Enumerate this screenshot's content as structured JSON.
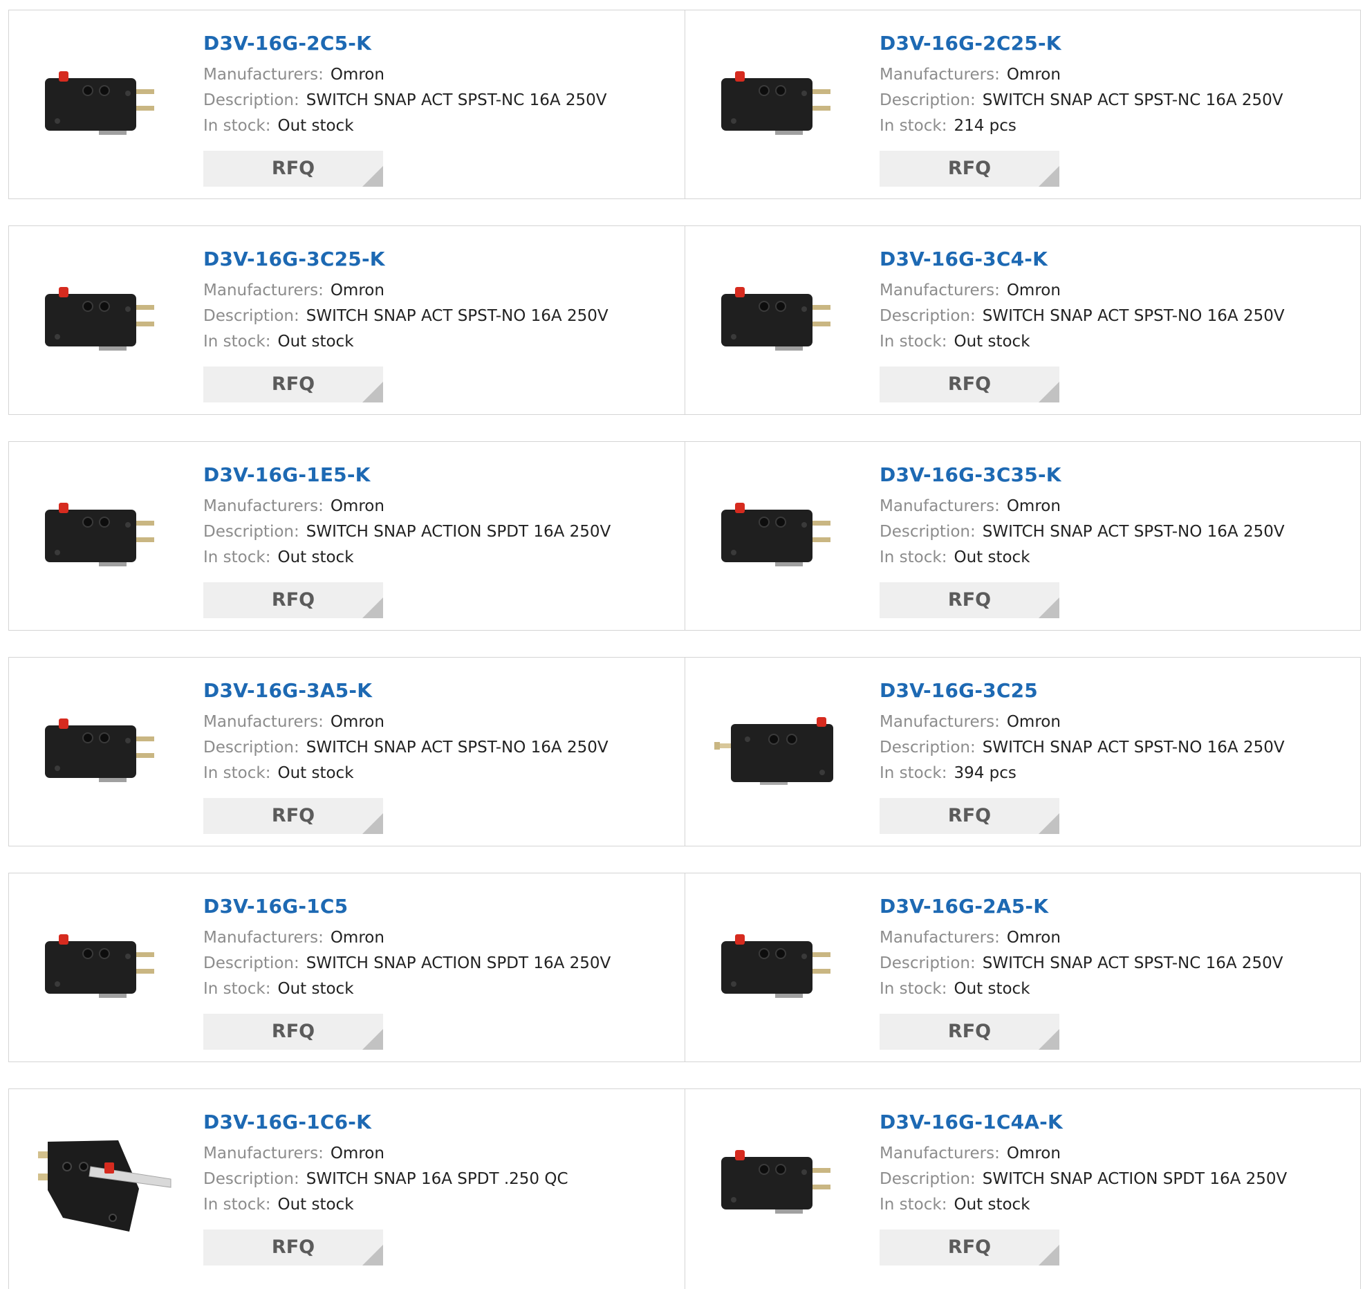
{
  "labels": {
    "manufacturers": "Manufacturers:",
    "description": "Description:",
    "in_stock": "In stock:",
    "rfq": "RFQ"
  },
  "colors": {
    "link": "#1d69b3",
    "label": "#8c8c8c",
    "value": "#222222",
    "button_bg": "#efefef",
    "button_text": "#5b5b5b",
    "border": "#d4d4d4"
  },
  "products": [
    {
      "part": "D3V-16G-2C5-K",
      "manufacturer": "Omron",
      "description": "SWITCH SNAP ACT SPST-NC 16A 250V",
      "stock": "Out stock",
      "image": "microswitch-side"
    },
    {
      "part": "D3V-16G-2C25-K",
      "manufacturer": "Omron",
      "description": "SWITCH SNAP ACT SPST-NC 16A 250V",
      "stock": "214 pcs",
      "image": "microswitch-side"
    },
    {
      "part": "D3V-16G-3C25-K",
      "manufacturer": "Omron",
      "description": "SWITCH SNAP ACT SPST-NO 16A 250V",
      "stock": "Out stock",
      "image": "microswitch-side"
    },
    {
      "part": "D3V-16G-3C4-K",
      "manufacturer": "Omron",
      "description": "SWITCH SNAP ACT SPST-NO 16A 250V",
      "stock": "Out stock",
      "image": "microswitch-side"
    },
    {
      "part": "D3V-16G-1E5-K",
      "manufacturer": "Omron",
      "description": "SWITCH SNAP ACTION SPDT 16A 250V",
      "stock": "Out stock",
      "image": "microswitch-side"
    },
    {
      "part": "D3V-16G-3C35-K",
      "manufacturer": "Omron",
      "description": "SWITCH SNAP ACT SPST-NO 16A 250V",
      "stock": "Out stock",
      "image": "microswitch-side"
    },
    {
      "part": "D3V-16G-3A5-K",
      "manufacturer": "Omron",
      "description": "SWITCH SNAP ACT SPST-NO 16A 250V",
      "stock": "Out stock",
      "image": "microswitch-side"
    },
    {
      "part": "D3V-16G-3C25",
      "manufacturer": "Omron",
      "description": "SWITCH SNAP ACT SPST-NO 16A 250V",
      "stock": "394 pcs",
      "image": "microswitch-mirrored"
    },
    {
      "part": "D3V-16G-1C5",
      "manufacturer": "Omron",
      "description": "SWITCH SNAP ACTION SPDT 16A 250V",
      "stock": "Out stock",
      "image": "microswitch-side"
    },
    {
      "part": "D3V-16G-2A5-K",
      "manufacturer": "Omron",
      "description": "SWITCH SNAP ACT SPST-NC 16A 250V",
      "stock": "Out stock",
      "image": "microswitch-side"
    },
    {
      "part": "D3V-16G-1C6-K",
      "manufacturer": "Omron",
      "description": "SWITCH SNAP 16A SPDT .250 QC",
      "stock": "Out stock",
      "image": "microswitch-lever"
    },
    {
      "part": "D3V-16G-1C4A-K",
      "manufacturer": "Omron",
      "description": "SWITCH SNAP ACTION SPDT 16A 250V",
      "stock": "Out stock",
      "image": "microswitch-side"
    }
  ]
}
